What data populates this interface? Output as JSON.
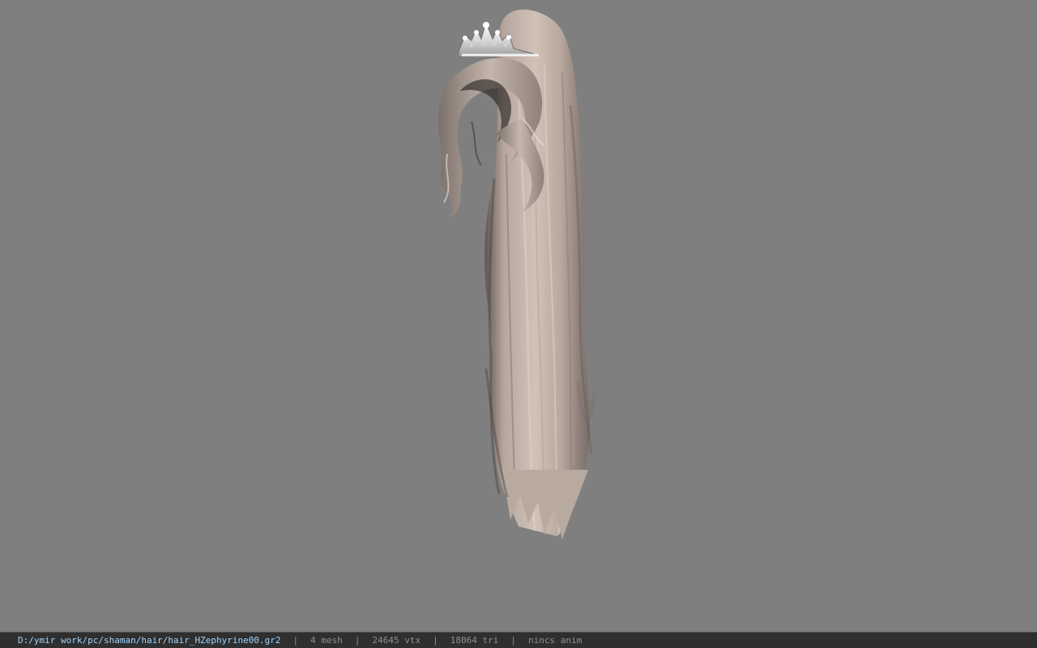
{
  "statusbar": {
    "file_path": "D:/ymir work/pc/shaman/hair/hair_HZephyrine00.gr2",
    "separator": "|",
    "mesh_count": "4 mesh",
    "vertex_count": "24645 vtx",
    "triangle_count": "18064 tri",
    "anim_status": "nincs anim"
  },
  "viewport": {
    "background": "#7f7f7f",
    "model_icon": "hair-model-icon",
    "tiara_icon": "tiara-icon"
  }
}
